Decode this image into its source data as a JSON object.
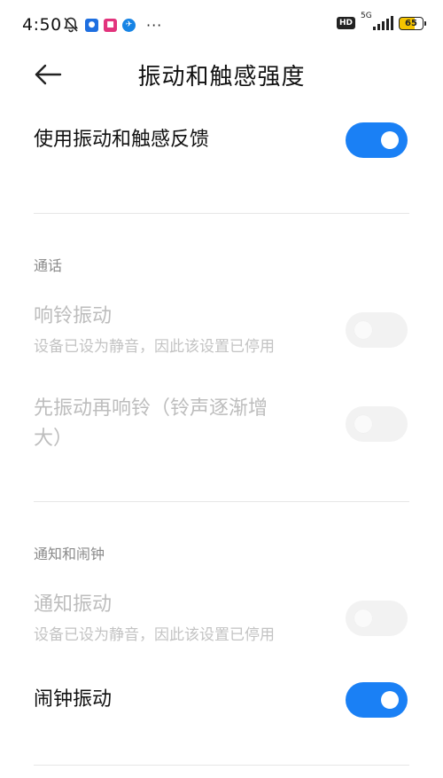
{
  "status_bar": {
    "time": "4:50",
    "network": "5G",
    "hd": "HD",
    "battery": "65",
    "battery_level": 0.65,
    "more": "···",
    "icons": [
      "bell-off-icon",
      "app-notification-icon",
      "shopping-app-icon",
      "bird-app-icon",
      "more-icon"
    ]
  },
  "header": {
    "title": "振动和触感强度",
    "back_icon": "arrow-left-icon"
  },
  "settings": {
    "master": {
      "label": "使用振动和触感反馈",
      "enabled": true
    },
    "calls_section": {
      "label": "通话"
    },
    "ringer": {
      "label": "响铃振动",
      "subtitle": "设备已设为静音，因此该设置已停用",
      "enabled": false
    },
    "ramp": {
      "label_line1": "先振动再响铃（铃声逐渐增",
      "label_line2": "大）",
      "enabled": false
    },
    "notif_section": {
      "label": "通知和闹钟"
    },
    "notification": {
      "label": "通知振动",
      "subtitle": "设备已设为静音，因此该设置已停用",
      "enabled": false
    },
    "alarm": {
      "label": "闹钟振动",
      "enabled": true
    }
  },
  "colors": {
    "accent": "#1a80f5",
    "disabled_text": "#bdbdbd",
    "section_label": "#8a8a8a"
  }
}
